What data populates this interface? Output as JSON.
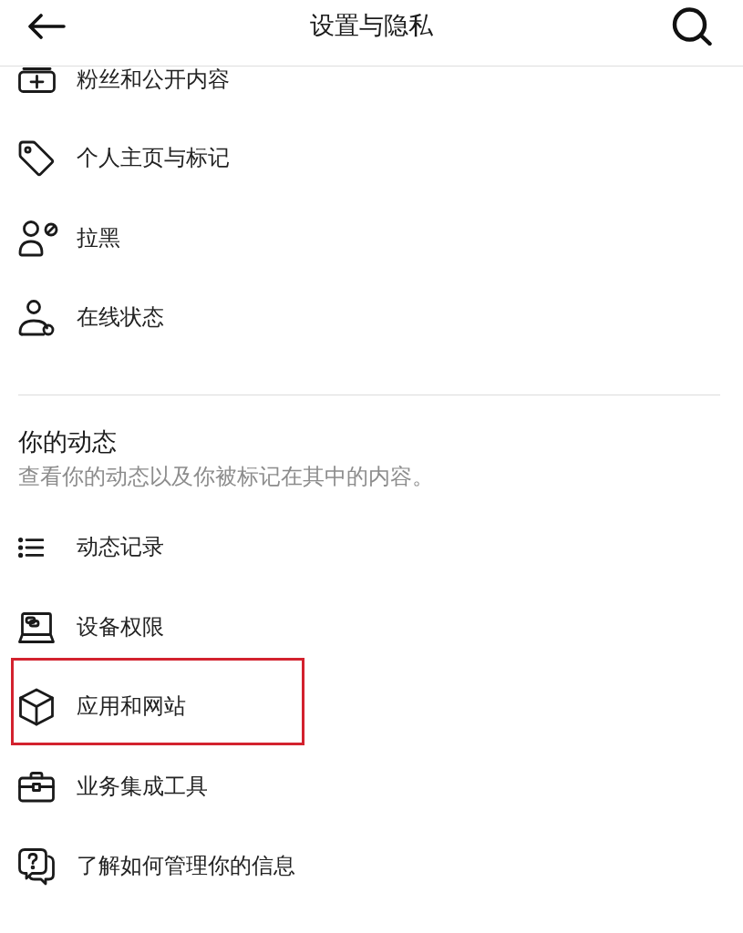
{
  "header": {
    "title": "设置与隐私"
  },
  "items": [
    {
      "label": "粉丝和公开内容"
    },
    {
      "label": "个人主页与标记"
    },
    {
      "label": "拉黑"
    },
    {
      "label": "在线状态"
    }
  ],
  "activity": {
    "title": "你的动态",
    "subtitle": "查看你的动态以及你被标记在其中的内容。",
    "items": [
      {
        "label": "动态记录",
        "highlighted": false
      },
      {
        "label": "设备权限",
        "highlighted": false
      },
      {
        "label": "应用和网站",
        "highlighted": true
      },
      {
        "label": "业务集成工具",
        "highlighted": false
      },
      {
        "label": "了解如何管理你的信息",
        "highlighted": false
      }
    ]
  }
}
